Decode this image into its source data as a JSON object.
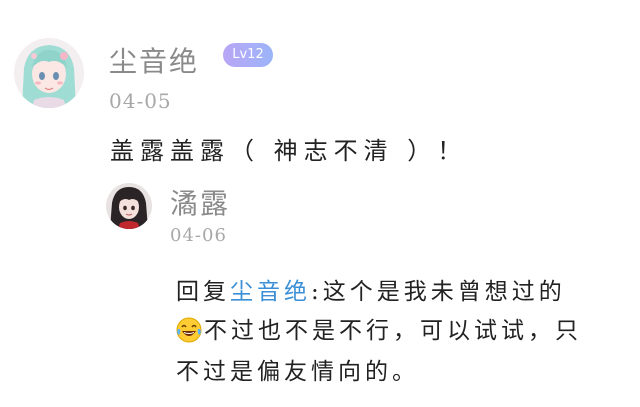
{
  "comment": {
    "username": "尘音绝",
    "level": "Lv12",
    "date": "04-05",
    "text": "盖露盖露（ 神志不清 ）！"
  },
  "reply": {
    "username": "潏露",
    "date": "04-06",
    "prefix": "回复",
    "mention": "尘音绝",
    "line1_rest": ":这个是我未曾想过的",
    "emoji": "laughing-tears-icon",
    "line2_rest": "不过也不是不行，可以试试，只",
    "line3": "不过是偏友情向的。"
  },
  "colors": {
    "mention": "#3a8fd6",
    "username": "#8a8a8a",
    "date": "#a8a8a8",
    "badge_start": "#b9a6f6",
    "badge_end": "#9bb4f8"
  }
}
